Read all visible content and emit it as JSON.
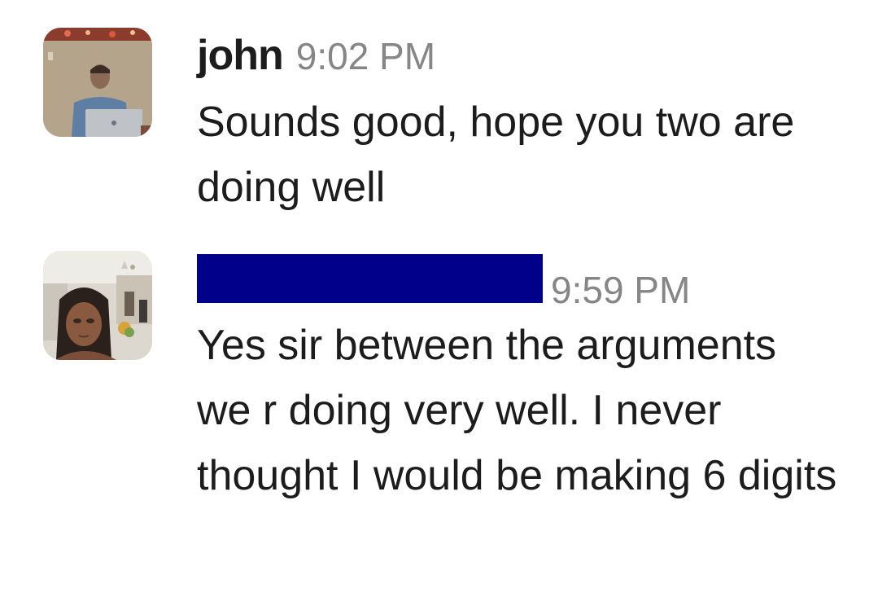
{
  "messages": [
    {
      "sender": "john",
      "time": "9:02 PM",
      "text": "Sounds good, hope you two are doing well",
      "avatar_icon": "user-avatar-man-at-laptop"
    },
    {
      "sender": "",
      "sender_redacted": true,
      "time": "9:59 PM",
      "text": "Yes sir between the arguments we r doing very well. I never thought I would be making 6 digits",
      "avatar_icon": "user-avatar-woman-selfie"
    }
  ],
  "colors": {
    "text": "#1d1c1d",
    "timestamp": "#868686",
    "redaction": "#00008b",
    "background": "#ffffff"
  }
}
